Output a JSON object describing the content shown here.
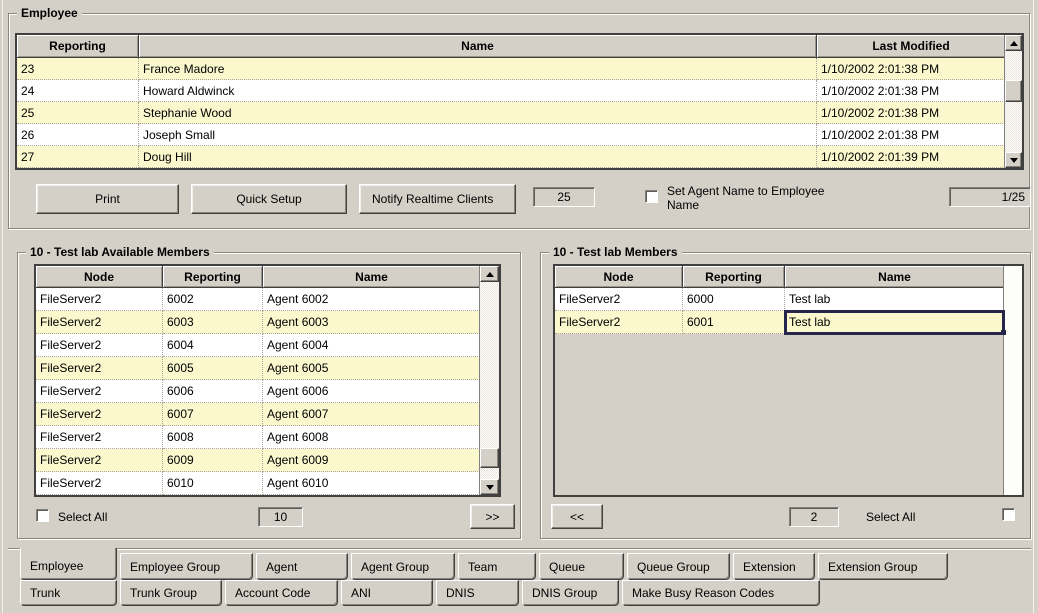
{
  "colors": {
    "dialog": "#D4D0C8",
    "row_alt": "#FBF8CE",
    "selection_border": "#26264C"
  },
  "employee": {
    "title": "Employee",
    "table": {
      "columns": [
        "Reporting",
        "Name",
        "Last Modified"
      ],
      "rows": [
        [
          "23",
          "France Madore",
          "1/10/2002 2:01:38 PM"
        ],
        [
          "24",
          "Howard Aldwinck",
          "1/10/2002 2:01:38 PM"
        ],
        [
          "25",
          "Stephanie Wood",
          "1/10/2002 2:01:38 PM"
        ],
        [
          "26",
          "Joseph Small",
          "1/10/2002 2:01:38 PM"
        ],
        [
          "27",
          "Doug Hill",
          "1/10/2002 2:01:39 PM"
        ]
      ]
    },
    "buttons": {
      "print": "Print",
      "quick_setup": "Quick Setup",
      "notify": "Notify Realtime Clients"
    },
    "count_value": "25",
    "checkbox_label": "Set Agent Name to Employee Name",
    "checkbox_checked": false,
    "page_indicator": "1/25"
  },
  "available": {
    "title": "10 - Test lab Available Members",
    "columns": [
      "Node",
      "Reporting",
      "Name"
    ],
    "rows": [
      [
        "FileServer2",
        "6002",
        "Agent 6002"
      ],
      [
        "FileServer2",
        "6003",
        "Agent 6003"
      ],
      [
        "FileServer2",
        "6004",
        "Agent 6004"
      ],
      [
        "FileServer2",
        "6005",
        "Agent 6005"
      ],
      [
        "FileServer2",
        "6006",
        "Agent 6006"
      ],
      [
        "FileServer2",
        "6007",
        "Agent 6007"
      ],
      [
        "FileServer2",
        "6008",
        "Agent 6008"
      ],
      [
        "FileServer2",
        "6009",
        "Agent 6009"
      ],
      [
        "FileServer2",
        "6010",
        "Agent 6010"
      ]
    ],
    "select_all_label": "Select All",
    "select_all_checked": false,
    "count_value": "10",
    "move_label": ">>"
  },
  "members": {
    "title": "10 - Test lab Members",
    "columns": [
      "Node",
      "Reporting",
      "Name"
    ],
    "rows": [
      [
        "FileServer2",
        "6000",
        "Test lab"
      ],
      [
        "FileServer2",
        "6001",
        "Test lab"
      ]
    ],
    "selection": {
      "row": 1,
      "col": 2
    },
    "move_label": "<<",
    "count_value": "2",
    "select_all_label": "Select All",
    "select_all_checked": false
  },
  "tabs": {
    "active": "Employee",
    "row1": [
      "Employee",
      "Employee Group",
      "Agent",
      "Agent Group",
      "Team",
      "Queue",
      "Queue Group",
      "Extension",
      "Extension Group"
    ],
    "row2": [
      "Trunk",
      "Trunk Group",
      "Account Code",
      "ANI",
      "DNIS",
      "DNIS Group",
      "Make Busy Reason Codes"
    ]
  }
}
